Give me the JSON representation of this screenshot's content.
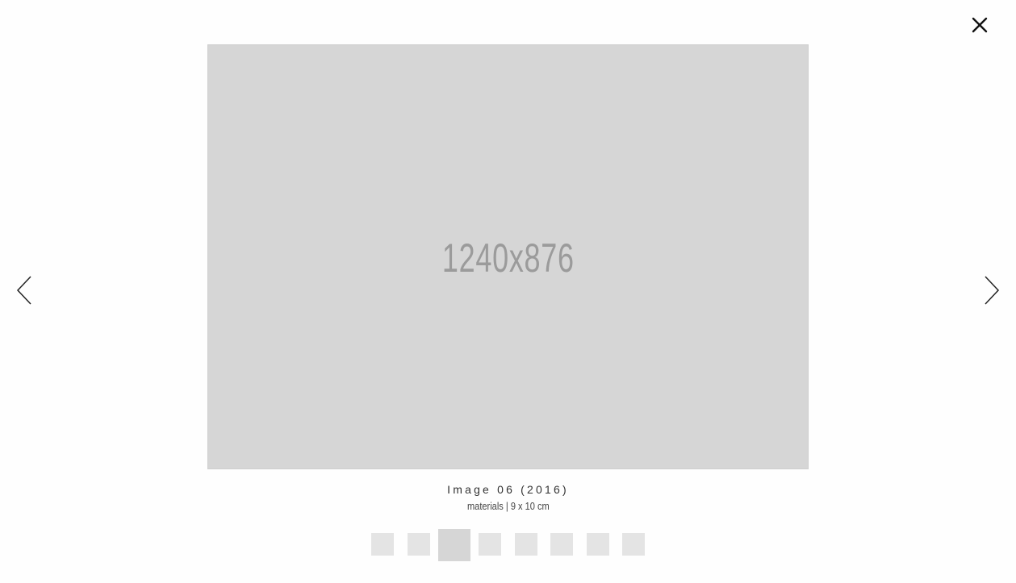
{
  "lightbox": {
    "image": {
      "placeholder_text": "1240x876"
    },
    "caption": {
      "title": "Image 06 (2016)",
      "subtitle": "materials | 9 x 10 cm"
    },
    "thumbnails": {
      "count": 8,
      "active_index": 2
    },
    "icons": {
      "close": "close-icon",
      "previous": "chevron-left-icon",
      "next": "chevron-right-icon"
    },
    "colors": {
      "placeholder_bg": "#d6d6d6",
      "placeholder_text": "#9b9b9b",
      "thumb_bg": "#e4e4e4"
    }
  }
}
